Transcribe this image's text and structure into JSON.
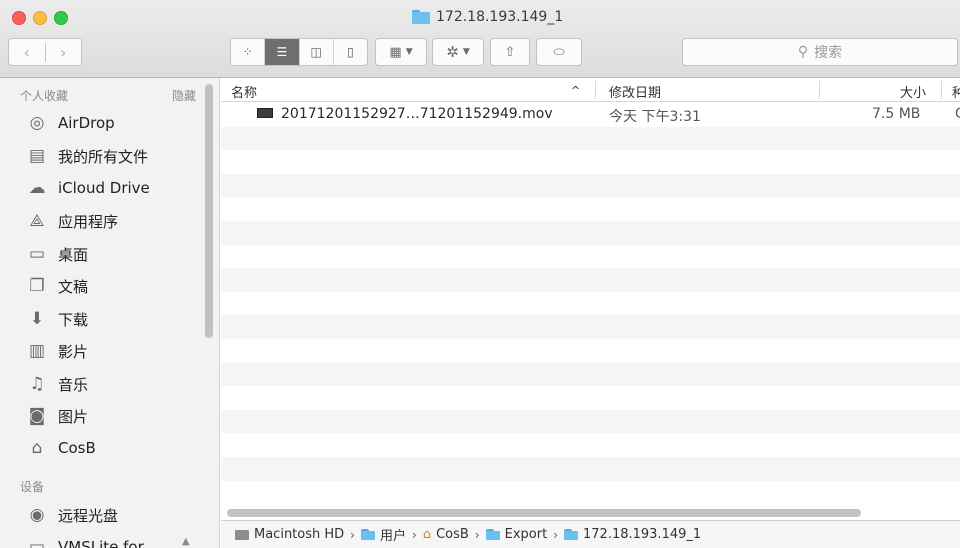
{
  "window": {
    "title": "172.18.193.149_1"
  },
  "toolbar": {
    "back_icon": "chevron-left-icon",
    "forward_icon": "chevron-right-icon",
    "view_icons": [
      "icon-view-icon",
      "list-view-icon",
      "column-view-icon",
      "cover-flow-icon"
    ],
    "active_view": "list",
    "search_placeholder": "搜索"
  },
  "sidebar": {
    "favorites_header": "个人收藏",
    "hide_label": "隐藏",
    "favorites": [
      {
        "label": "AirDrop",
        "icon": "airdrop-icon"
      },
      {
        "label": "我的所有文件",
        "icon": "all-files-icon"
      },
      {
        "label": "iCloud Drive",
        "icon": "cloud-icon"
      },
      {
        "label": "应用程序",
        "icon": "applications-icon"
      },
      {
        "label": "桌面",
        "icon": "desktop-icon"
      },
      {
        "label": "文稿",
        "icon": "documents-icon"
      },
      {
        "label": "下载",
        "icon": "download-icon"
      },
      {
        "label": "影片",
        "icon": "movies-icon"
      },
      {
        "label": "音乐",
        "icon": "music-icon"
      },
      {
        "label": "图片",
        "icon": "pictures-icon"
      },
      {
        "label": "CosB",
        "icon": "home-icon"
      }
    ],
    "devices_header": "设备",
    "devices": [
      {
        "label": "远程光盘",
        "icon": "disc-icon"
      },
      {
        "label": "VMSLite for",
        "icon": "drive-icon"
      }
    ]
  },
  "list": {
    "columns": {
      "name": "名称",
      "modified": "修改日期",
      "size": "大小",
      "kind": "种"
    },
    "files": [
      {
        "name": "20171201152927…71201152949.mov",
        "modified": "今天 下午3:31",
        "size": "7.5 MB",
        "kind": "Q"
      }
    ]
  },
  "pathbar": {
    "segments": [
      "Macintosh HD",
      "用户",
      "CosB",
      "Export",
      "172.18.193.149_1"
    ]
  }
}
